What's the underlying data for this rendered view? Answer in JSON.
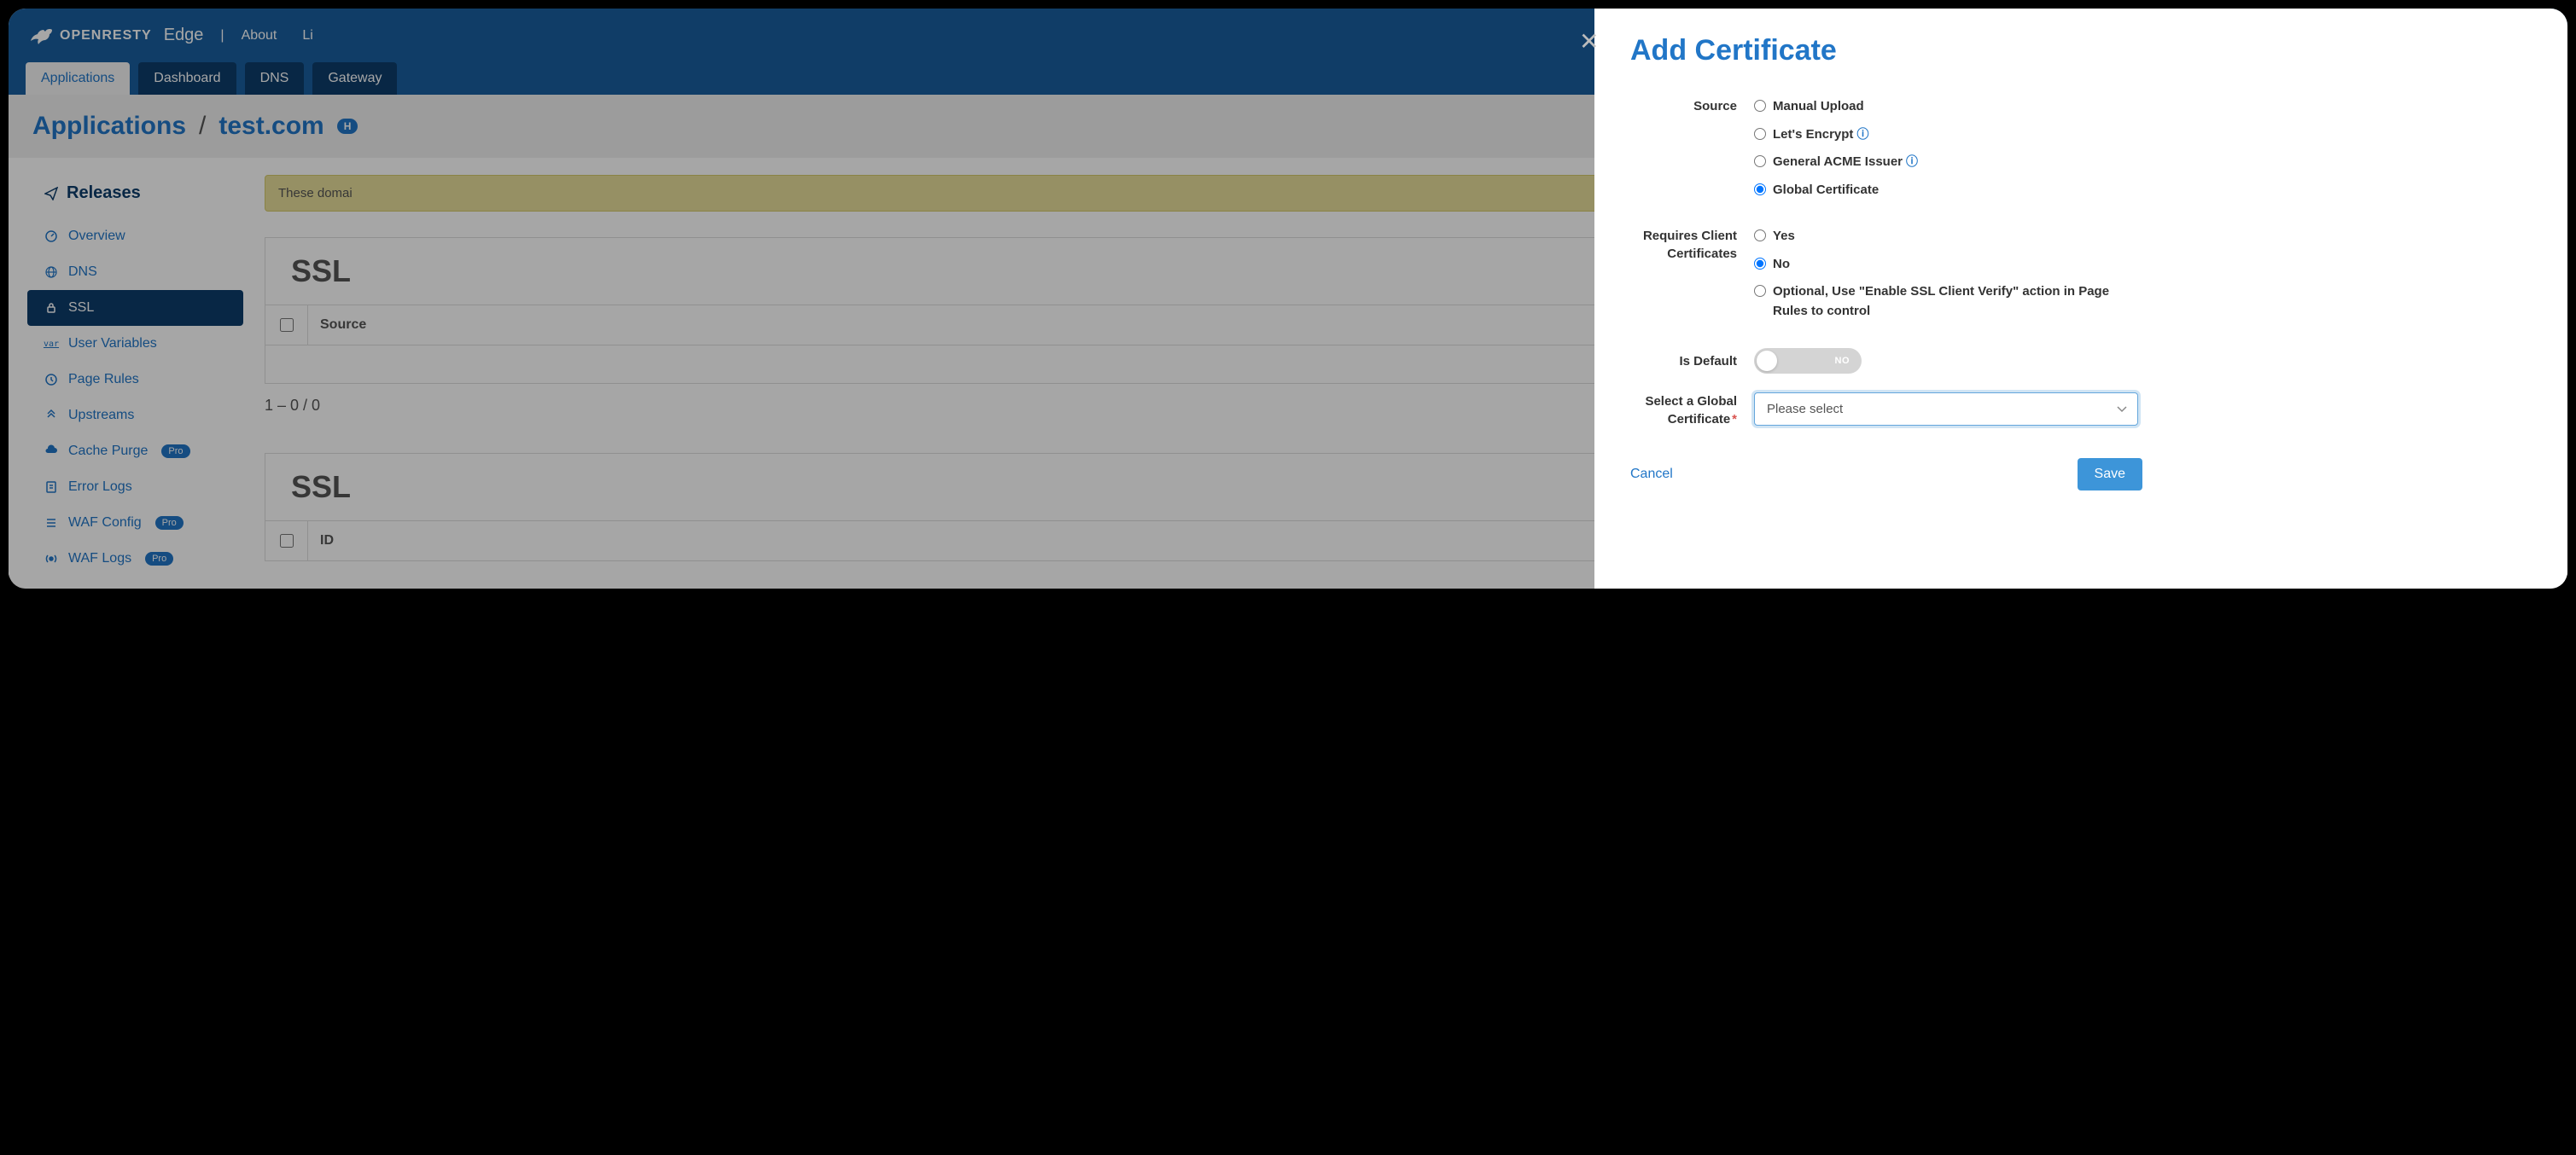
{
  "header": {
    "brand": "OPENRESTY",
    "product": "Edge",
    "links": [
      "About",
      "Li"
    ]
  },
  "tabs": [
    {
      "label": "Applications",
      "active": true
    },
    {
      "label": "Dashboard",
      "active": false
    },
    {
      "label": "DNS",
      "active": false
    },
    {
      "label": "Gateway",
      "active": false
    }
  ],
  "breadcrumb": {
    "root": "Applications",
    "current": "test.com",
    "badge": "H"
  },
  "sidebar": {
    "heading": "Releases",
    "items": [
      {
        "label": "Overview",
        "icon": "gauge"
      },
      {
        "label": "DNS",
        "icon": "globe"
      },
      {
        "label": "SSL",
        "icon": "lock",
        "active": true
      },
      {
        "label": "User Variables",
        "icon": "var"
      },
      {
        "label": "Page Rules",
        "icon": "clock"
      },
      {
        "label": "Upstreams",
        "icon": "chevrons"
      },
      {
        "label": "Cache Purge",
        "icon": "cloud",
        "pro": true
      },
      {
        "label": "Error Logs",
        "icon": "doc"
      },
      {
        "label": "WAF Config",
        "icon": "list",
        "pro": true
      },
      {
        "label": "WAF Logs",
        "icon": "broadcast",
        "pro": true
      }
    ],
    "pro_label": "Pro"
  },
  "content": {
    "alert": "These domai",
    "section1_title": "SSL",
    "section2_title": "SSL",
    "columns": {
      "source": "Source",
      "id": "ID"
    },
    "pagination": "1 – 0 / 0"
  },
  "modal": {
    "title": "Add Certificate",
    "labels": {
      "source": "Source",
      "requires_client": "Requires Client Certificates",
      "is_default": "Is Default",
      "select_global": "Select a Global Certificate"
    },
    "source_options": [
      {
        "label": "Manual Upload",
        "info": false
      },
      {
        "label": "Let's Encrypt",
        "info": true
      },
      {
        "label": "General ACME Issuer",
        "info": true
      },
      {
        "label": "Global Certificate",
        "info": false,
        "checked": true
      }
    ],
    "client_cert_options": [
      {
        "label": "Yes"
      },
      {
        "label": "No",
        "checked": true
      },
      {
        "label": "Optional, Use \"Enable SSL Client Verify\" action in Page Rules to control"
      }
    ],
    "toggle_state": "NO",
    "select_placeholder": "Please select",
    "cancel": "Cancel",
    "save": "Save"
  }
}
